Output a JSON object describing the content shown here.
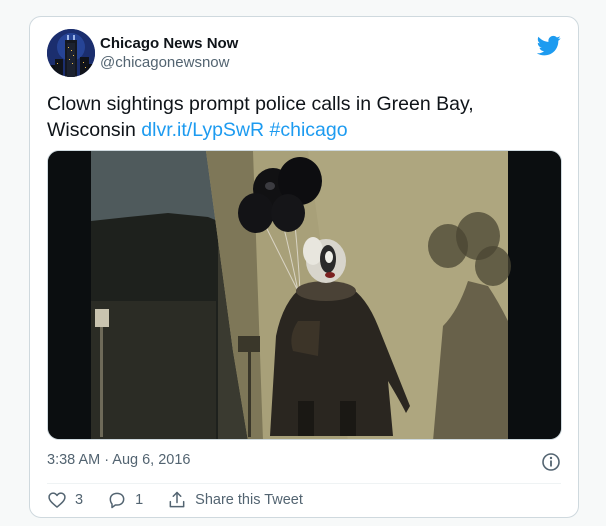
{
  "tweet": {
    "author": {
      "display_name": "Chicago News Now",
      "handle": "@chicagonewsnow",
      "avatar_icon": "city-skyline-avatar"
    },
    "brand_icon": "twitter-bird-icon",
    "brand_color": "#1d9bf0",
    "text": "Clown sightings prompt police calls in Green Bay, Wisconsin",
    "link": "dlvr.it/LypSwR",
    "hashtag": "#chicago",
    "media": {
      "icon": "photo-clown-with-balloons"
    },
    "timestamp": "3:38 AM · Aug 6, 2016",
    "info_icon": "info-icon"
  },
  "actions": {
    "like_count": "3",
    "reply_count": "1",
    "share_label": "Share this Tweet"
  }
}
